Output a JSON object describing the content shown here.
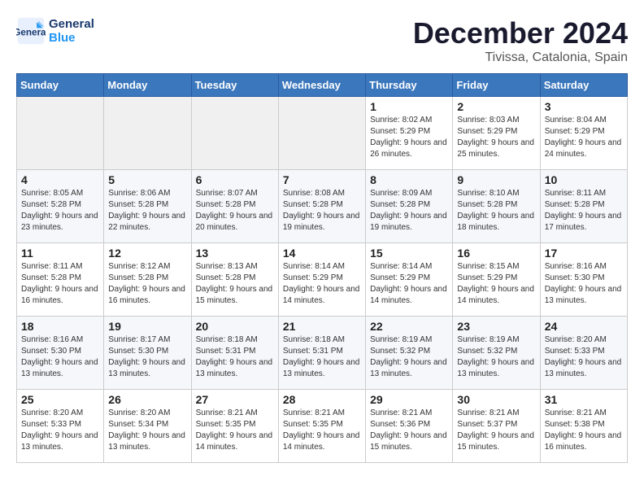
{
  "header": {
    "logo_line1": "General",
    "logo_line2": "Blue",
    "month": "December 2024",
    "location": "Tivissa, Catalonia, Spain"
  },
  "weekdays": [
    "Sunday",
    "Monday",
    "Tuesday",
    "Wednesday",
    "Thursday",
    "Friday",
    "Saturday"
  ],
  "days": [
    {
      "date": null
    },
    {
      "date": null
    },
    {
      "date": null
    },
    {
      "date": null
    },
    {
      "num": "1",
      "rise": "8:02 AM",
      "set": "5:29 PM",
      "daylight": "9 hours and 26 minutes."
    },
    {
      "num": "2",
      "rise": "8:03 AM",
      "set": "5:29 PM",
      "daylight": "9 hours and 25 minutes."
    },
    {
      "num": "3",
      "rise": "8:04 AM",
      "set": "5:29 PM",
      "daylight": "9 hours and 24 minutes."
    },
    {
      "num": "4",
      "rise": "8:05 AM",
      "set": "5:28 PM",
      "daylight": "9 hours and 23 minutes."
    },
    {
      "num": "5",
      "rise": "8:06 AM",
      "set": "5:28 PM",
      "daylight": "9 hours and 22 minutes."
    },
    {
      "num": "6",
      "rise": "8:07 AM",
      "set": "5:28 PM",
      "daylight": "9 hours and 20 minutes."
    },
    {
      "num": "7",
      "rise": "8:08 AM",
      "set": "5:28 PM",
      "daylight": "9 hours and 19 minutes."
    },
    {
      "num": "8",
      "rise": "8:09 AM",
      "set": "5:28 PM",
      "daylight": "9 hours and 19 minutes."
    },
    {
      "num": "9",
      "rise": "8:10 AM",
      "set": "5:28 PM",
      "daylight": "9 hours and 18 minutes."
    },
    {
      "num": "10",
      "rise": "8:11 AM",
      "set": "5:28 PM",
      "daylight": "9 hours and 17 minutes."
    },
    {
      "num": "11",
      "rise": "8:11 AM",
      "set": "5:28 PM",
      "daylight": "9 hours and 16 minutes."
    },
    {
      "num": "12",
      "rise": "8:12 AM",
      "set": "5:28 PM",
      "daylight": "9 hours and 16 minutes."
    },
    {
      "num": "13",
      "rise": "8:13 AM",
      "set": "5:28 PM",
      "daylight": "9 hours and 15 minutes."
    },
    {
      "num": "14",
      "rise": "8:14 AM",
      "set": "5:29 PM",
      "daylight": "9 hours and 14 minutes."
    },
    {
      "num": "15",
      "rise": "8:14 AM",
      "set": "5:29 PM",
      "daylight": "9 hours and 14 minutes."
    },
    {
      "num": "16",
      "rise": "8:15 AM",
      "set": "5:29 PM",
      "daylight": "9 hours and 14 minutes."
    },
    {
      "num": "17",
      "rise": "8:16 AM",
      "set": "5:30 PM",
      "daylight": "9 hours and 13 minutes."
    },
    {
      "num": "18",
      "rise": "8:16 AM",
      "set": "5:30 PM",
      "daylight": "9 hours and 13 minutes."
    },
    {
      "num": "19",
      "rise": "8:17 AM",
      "set": "5:30 PM",
      "daylight": "9 hours and 13 minutes."
    },
    {
      "num": "20",
      "rise": "8:18 AM",
      "set": "5:31 PM",
      "daylight": "9 hours and 13 minutes."
    },
    {
      "num": "21",
      "rise": "8:18 AM",
      "set": "5:31 PM",
      "daylight": "9 hours and 13 minutes."
    },
    {
      "num": "22",
      "rise": "8:19 AM",
      "set": "5:32 PM",
      "daylight": "9 hours and 13 minutes."
    },
    {
      "num": "23",
      "rise": "8:19 AM",
      "set": "5:32 PM",
      "daylight": "9 hours and 13 minutes."
    },
    {
      "num": "24",
      "rise": "8:20 AM",
      "set": "5:33 PM",
      "daylight": "9 hours and 13 minutes."
    },
    {
      "num": "25",
      "rise": "8:20 AM",
      "set": "5:33 PM",
      "daylight": "9 hours and 13 minutes."
    },
    {
      "num": "26",
      "rise": "8:20 AM",
      "set": "5:34 PM",
      "daylight": "9 hours and 13 minutes."
    },
    {
      "num": "27",
      "rise": "8:21 AM",
      "set": "5:35 PM",
      "daylight": "9 hours and 14 minutes."
    },
    {
      "num": "28",
      "rise": "8:21 AM",
      "set": "5:35 PM",
      "daylight": "9 hours and 14 minutes."
    },
    {
      "num": "29",
      "rise": "8:21 AM",
      "set": "5:36 PM",
      "daylight": "9 hours and 15 minutes."
    },
    {
      "num": "30",
      "rise": "8:21 AM",
      "set": "5:37 PM",
      "daylight": "9 hours and 15 minutes."
    },
    {
      "num": "31",
      "rise": "8:21 AM",
      "set": "5:38 PM",
      "daylight": "9 hours and 16 minutes."
    }
  ]
}
